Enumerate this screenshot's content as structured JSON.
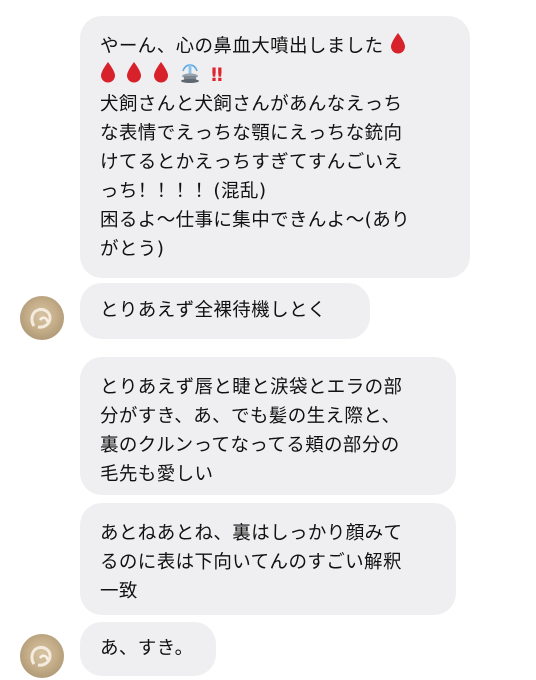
{
  "conversation": {
    "messages": [
      {
        "sender": "me",
        "lines": [
          "やーん、心の鼻血大噴出しました",
          "‼",
          "犬飼さんと犬飼さんがあんなえっち",
          "な表情でえっちな顎にえっちな銃向",
          "けてるとかえっちすぎてすんごいえ",
          "っち！！！！(混乱)",
          "困るよ〜仕事に集中できんよ〜(あり",
          "がとう)"
        ]
      },
      {
        "sender": "me",
        "lines": [
          "とりあえず全裸待機しとく"
        ]
      },
      {
        "sender": "me",
        "lines": [
          "とりあえず唇と睫と涙袋とエラの部",
          "分がすき、あ、でも髪の生え際と、",
          "裏のクルンってなってる頬の部分の",
          "毛先も愛しい"
        ]
      },
      {
        "sender": "me",
        "lines": [
          "あとねあとね、裏はしっかり顔みて",
          "るのに表は下向いてんのすごい解釈",
          "一致"
        ]
      },
      {
        "sender": "me",
        "lines": [
          "あ、すき。"
        ]
      }
    ]
  },
  "icons": {
    "drop": "blood-drop-icon",
    "fountain": "fountain-icon",
    "avatar": "user-avatar"
  },
  "colors": {
    "bubble": "#efeff1",
    "text": "#111111",
    "drop": "#d7222c",
    "bang": "#e0242e"
  }
}
